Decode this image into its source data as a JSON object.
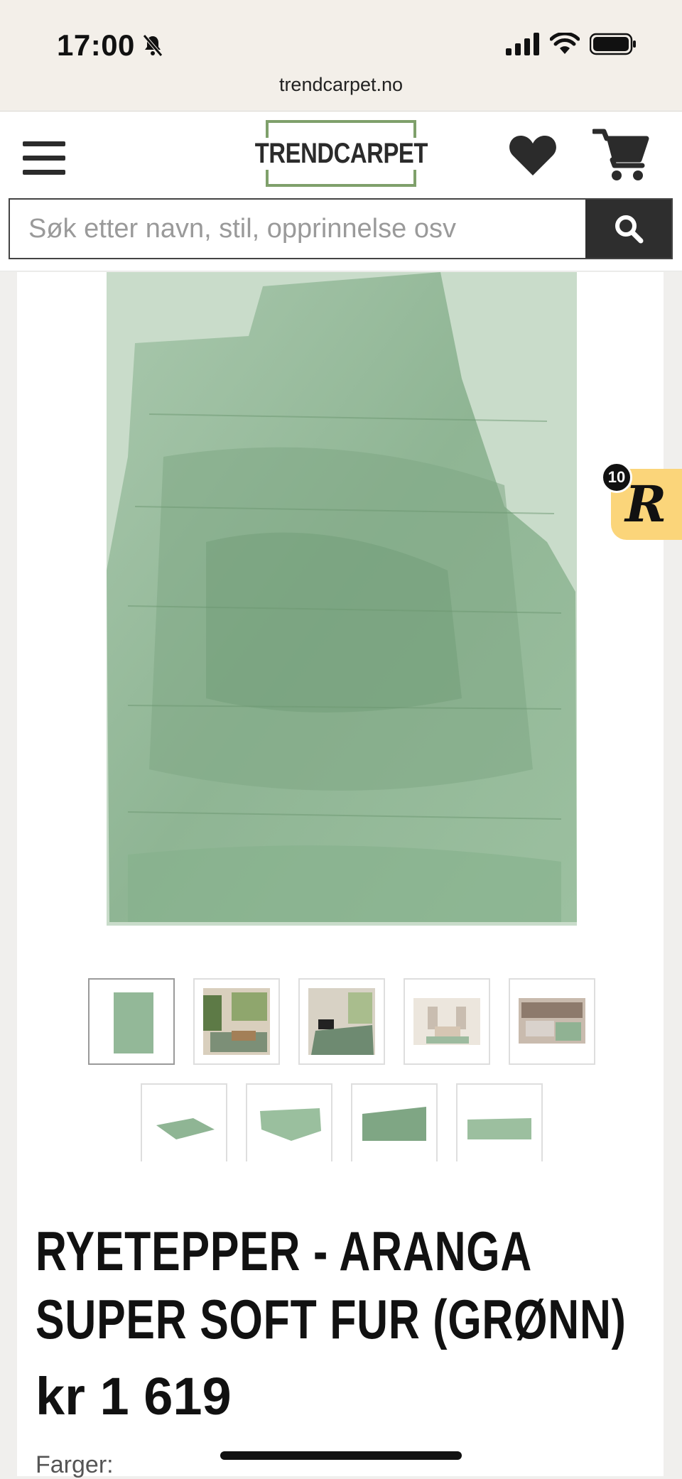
{
  "status_bar": {
    "time": "17:00",
    "url": "trendcarpet.no"
  },
  "header": {
    "logo_text": "TRENDCARPET",
    "search_placeholder": "Søk etter navn, stil, opprinnelse osv"
  },
  "rewards_widget": {
    "count": "10",
    "letter": "R"
  },
  "product": {
    "title": "Ryetepper - Aranga Super Soft Fur (Grønn)",
    "price": "kr 1 619",
    "colors_label": "Farger:",
    "thumbnail_count": 9
  },
  "colors": {
    "accent_green": "#7fa06b",
    "rug_green": "#8fb594",
    "rewards_yellow": "#fbd57a",
    "search_button": "#2e2e2e"
  }
}
